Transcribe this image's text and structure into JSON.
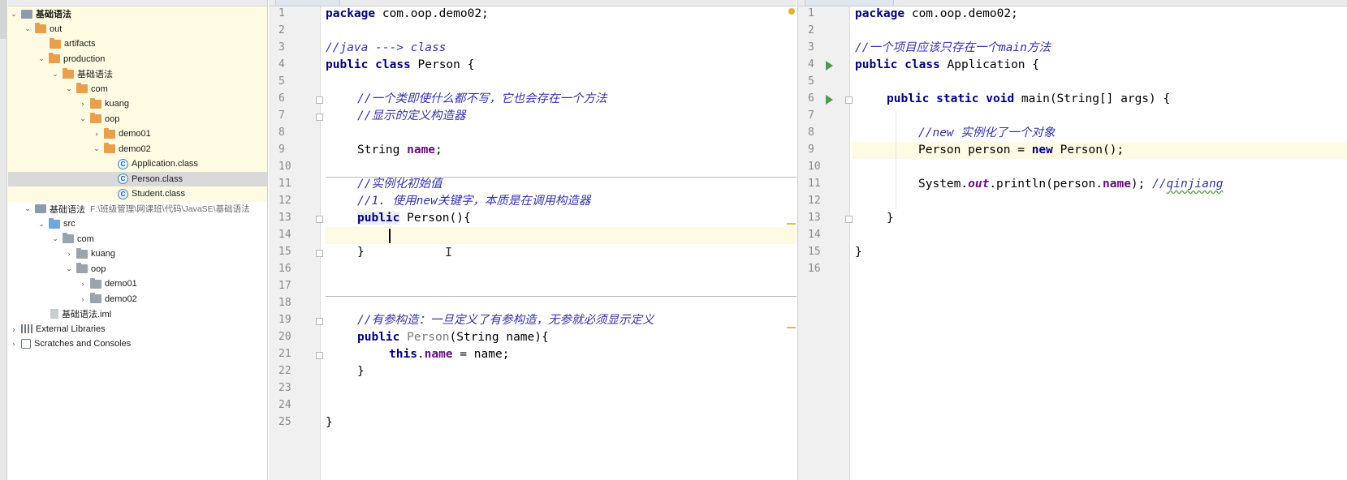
{
  "project_tree": {
    "items": [
      {
        "label": "基础语法"
      },
      {
        "label": "out"
      },
      {
        "label": "artifacts"
      },
      {
        "label": "production"
      },
      {
        "label": "基础语法"
      },
      {
        "label": "com"
      },
      {
        "label": "kuang"
      },
      {
        "label": "oop"
      },
      {
        "label": "demo01"
      },
      {
        "label": "demo02"
      },
      {
        "label": "Application.class"
      },
      {
        "label": "Person.class"
      },
      {
        "label": "Student.class"
      },
      {
        "label": "基础语法",
        "path": "F:\\班级管理\\网课班\\代码\\JavaSE\\基础语法"
      },
      {
        "label": "src"
      },
      {
        "label": "com"
      },
      {
        "label": "kuang"
      },
      {
        "label": "oop"
      },
      {
        "label": "demo01"
      },
      {
        "label": "demo02"
      },
      {
        "label": "基础语法.iml"
      },
      {
        "label": "External Libraries"
      },
      {
        "label": "Scratches and Consoles"
      }
    ],
    "class_icon_letter": "C"
  },
  "editor_left": {
    "line_numbers": [
      "1",
      "2",
      "3",
      "4",
      "5",
      "6",
      "7",
      "8",
      "9",
      "10",
      "11",
      "12",
      "13",
      "14",
      "15",
      "16",
      "17",
      "18",
      "19",
      "20",
      "21",
      "22",
      "23",
      "24",
      "25"
    ],
    "code": {
      "l1_kw": "package",
      "l1_rest": " com.oop.demo02;",
      "l3": "//java ---> class",
      "l4_kw1": "public",
      "l4_kw2": "class",
      "l4_rest": " Person {",
      "l6": "//一个类即使什么都不写，它也会存在一个方法",
      "l7": "//显示的定义构造器",
      "l9_type": "String ",
      "l9_field": "name",
      "l9_end": ";",
      "l11": "//实例化初始值",
      "l12": "//1. 使用new关键字，本质是在调用构造器",
      "l13_kw": "public",
      "l13_rest": " Person(){",
      "l15": "}",
      "l18": "//有参构造：一旦定义了有参构造，无参就必须显示定义",
      "l19_kw": "public",
      "l19_ctor": " Person",
      "l19_rest": "(String name){",
      "l20_kw": "this",
      "l20_dot": ".",
      "l20_field": "name",
      "l20_rest": " = name;",
      "l21": "}",
      "l24": "}"
    }
  },
  "editor_right": {
    "line_numbers": [
      "1",
      "2",
      "3",
      "4",
      "5",
      "6",
      "7",
      "8",
      "9",
      "10",
      "11",
      "12",
      "13",
      "14",
      "15",
      "16"
    ],
    "code": {
      "l1_kw": "package",
      "l1_rest": " com.oop.demo02;",
      "l3": "//一个项目应该只存在一个main方法",
      "l4_kw1": "public",
      "l4_kw2": "class",
      "l4_rest": " Application {",
      "l6_kw1": "public",
      "l6_kw2": "static",
      "l6_kw3": "void",
      "l6_rest": " main(String[] args) {",
      "l8": "//new 实例化了一个对象",
      "l9_a": "Person person = ",
      "l9_kw": "new",
      "l9_b": " Person();",
      "l11_a": "System.",
      "l11_static": "out",
      "l11_b": ".println(person.",
      "l11_field": "name",
      "l11_c": "); ",
      "l11_cm_a": "//",
      "l11_cm_b": "qinjiang",
      "l13": "}",
      "l15": "}"
    }
  }
}
